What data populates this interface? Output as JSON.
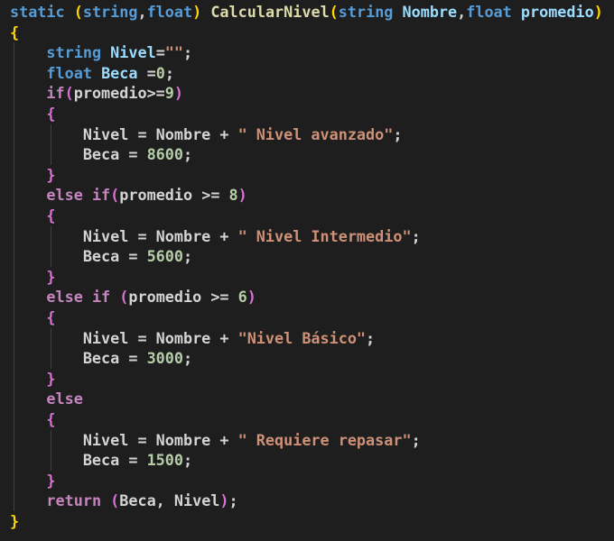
{
  "editor": {
    "theme_colors": {
      "background": "#1e1e1e",
      "keyword_blue": "#569cd6",
      "keyword_purple": "#c586c0",
      "function": "#dcdcaa",
      "identifier": "#9cdcfe",
      "string": "#ce9178",
      "number": "#b5cea8",
      "punctuation": "#d4d4d4",
      "brace_gold": "#ffd700",
      "brace_purple": "#da70d6",
      "brace_blue": "#179fff"
    },
    "lines": [
      [
        {
          "t": "static",
          "k": "kw-blue"
        },
        {
          "t": " ",
          "k": "punc"
        },
        {
          "t": "(",
          "k": "brace"
        },
        {
          "t": "string",
          "k": "kw-blue"
        },
        {
          "t": ",",
          "k": "punc"
        },
        {
          "t": "float",
          "k": "kw-blue"
        },
        {
          "t": ")",
          "k": "brace"
        },
        {
          "t": " ",
          "k": "punc"
        },
        {
          "t": "CalcularNivel",
          "k": "fn"
        },
        {
          "t": "(",
          "k": "brace"
        },
        {
          "t": "string",
          "k": "kw-blue"
        },
        {
          "t": " ",
          "k": "punc"
        },
        {
          "t": "Nombre",
          "k": "param"
        },
        {
          "t": ",",
          "k": "punc"
        },
        {
          "t": "float",
          "k": "kw-blue"
        },
        {
          "t": " ",
          "k": "punc"
        },
        {
          "t": "promedio",
          "k": "param"
        },
        {
          "t": ")",
          "k": "brace"
        }
      ],
      [
        {
          "t": "{",
          "k": "brace"
        }
      ],
      [
        {
          "t": "    ",
          "k": "punc"
        },
        {
          "t": "string",
          "k": "kw-blue"
        },
        {
          "t": " ",
          "k": "punc"
        },
        {
          "t": "Nivel",
          "k": "param"
        },
        {
          "t": "=",
          "k": "punc"
        },
        {
          "t": "\"\"",
          "k": "str"
        },
        {
          "t": ";",
          "k": "punc"
        }
      ],
      [
        {
          "t": "    ",
          "k": "punc"
        },
        {
          "t": "float",
          "k": "kw-blue"
        },
        {
          "t": " ",
          "k": "punc"
        },
        {
          "t": "Beca",
          "k": "param"
        },
        {
          "t": " =",
          "k": "punc"
        },
        {
          "t": "0",
          "k": "num"
        },
        {
          "t": ";",
          "k": "punc"
        }
      ],
      [
        {
          "t": "    ",
          "k": "punc"
        },
        {
          "t": "if",
          "k": "kw-purple"
        },
        {
          "t": "(",
          "k": "brace-purple"
        },
        {
          "t": "promedio",
          "k": "punc"
        },
        {
          "t": ">=",
          "k": "punc"
        },
        {
          "t": "9",
          "k": "num"
        },
        {
          "t": ")",
          "k": "brace-purple"
        }
      ],
      [
        {
          "t": "    ",
          "k": "punc"
        },
        {
          "t": "{",
          "k": "brace-purple"
        }
      ],
      [
        {
          "t": "        ",
          "k": "punc"
        },
        {
          "t": "Nivel = Nombre + ",
          "k": "punc"
        },
        {
          "t": "\" Nivel avanzado\"",
          "k": "str"
        },
        {
          "t": ";",
          "k": "punc"
        }
      ],
      [
        {
          "t": "        ",
          "k": "punc"
        },
        {
          "t": "Beca = ",
          "k": "punc"
        },
        {
          "t": "8600",
          "k": "num"
        },
        {
          "t": ";",
          "k": "punc"
        }
      ],
      [
        {
          "t": "    ",
          "k": "punc"
        },
        {
          "t": "}",
          "k": "brace-purple"
        }
      ],
      [
        {
          "t": "    ",
          "k": "punc"
        },
        {
          "t": "else",
          "k": "kw-purple"
        },
        {
          "t": " ",
          "k": "punc"
        },
        {
          "t": "if",
          "k": "kw-purple"
        },
        {
          "t": "(",
          "k": "brace-purple"
        },
        {
          "t": "promedio >= ",
          "k": "punc"
        },
        {
          "t": "8",
          "k": "num"
        },
        {
          "t": ")",
          "k": "brace-purple"
        }
      ],
      [
        {
          "t": "    ",
          "k": "punc"
        },
        {
          "t": "{",
          "k": "brace-purple"
        }
      ],
      [
        {
          "t": "        ",
          "k": "punc"
        },
        {
          "t": "Nivel = Nombre + ",
          "k": "punc"
        },
        {
          "t": "\" Nivel Intermedio\"",
          "k": "str"
        },
        {
          "t": ";",
          "k": "punc"
        }
      ],
      [
        {
          "t": "        ",
          "k": "punc"
        },
        {
          "t": "Beca = ",
          "k": "punc"
        },
        {
          "t": "5600",
          "k": "num"
        },
        {
          "t": ";",
          "k": "punc"
        }
      ],
      [
        {
          "t": "    ",
          "k": "punc"
        },
        {
          "t": "}",
          "k": "brace-purple"
        }
      ],
      [
        {
          "t": "    ",
          "k": "punc"
        },
        {
          "t": "else",
          "k": "kw-purple"
        },
        {
          "t": " ",
          "k": "punc"
        },
        {
          "t": "if",
          "k": "kw-purple"
        },
        {
          "t": " ",
          "k": "punc"
        },
        {
          "t": "(",
          "k": "brace-purple"
        },
        {
          "t": "promedio >= ",
          "k": "punc"
        },
        {
          "t": "6",
          "k": "num"
        },
        {
          "t": ")",
          "k": "brace-purple"
        }
      ],
      [
        {
          "t": "    ",
          "k": "punc"
        },
        {
          "t": "{",
          "k": "brace-purple"
        }
      ],
      [
        {
          "t": "        ",
          "k": "punc"
        },
        {
          "t": "Nivel = Nombre + ",
          "k": "punc"
        },
        {
          "t": "\"Nivel Básico\"",
          "k": "str"
        },
        {
          "t": ";",
          "k": "punc"
        }
      ],
      [
        {
          "t": "        ",
          "k": "punc"
        },
        {
          "t": "Beca = ",
          "k": "punc"
        },
        {
          "t": "3000",
          "k": "num"
        },
        {
          "t": ";",
          "k": "punc"
        }
      ],
      [
        {
          "t": "    ",
          "k": "punc"
        },
        {
          "t": "}",
          "k": "brace-purple"
        }
      ],
      [
        {
          "t": "    ",
          "k": "punc"
        },
        {
          "t": "else",
          "k": "kw-purple"
        }
      ],
      [
        {
          "t": "    ",
          "k": "punc"
        },
        {
          "t": "{",
          "k": "brace-purple"
        }
      ],
      [
        {
          "t": "        ",
          "k": "punc"
        },
        {
          "t": "Nivel = Nombre + ",
          "k": "punc"
        },
        {
          "t": "\" Requiere repasar\"",
          "k": "str"
        },
        {
          "t": ";",
          "k": "punc"
        }
      ],
      [
        {
          "t": "        ",
          "k": "punc"
        },
        {
          "t": "Beca = ",
          "k": "punc"
        },
        {
          "t": "1500",
          "k": "num"
        },
        {
          "t": ";",
          "k": "punc"
        }
      ],
      [
        {
          "t": "    ",
          "k": "punc"
        },
        {
          "t": "}",
          "k": "brace-purple"
        }
      ],
      [
        {
          "t": "    ",
          "k": "punc"
        },
        {
          "t": "return",
          "k": "kw-purple"
        },
        {
          "t": " ",
          "k": "punc"
        },
        {
          "t": "(",
          "k": "brace-purple"
        },
        {
          "t": "Beca, Nivel",
          "k": "punc"
        },
        {
          "t": ")",
          "k": "brace-purple"
        },
        {
          "t": ";",
          "k": "punc"
        }
      ],
      [
        {
          "t": "}",
          "k": "brace"
        }
      ]
    ]
  }
}
